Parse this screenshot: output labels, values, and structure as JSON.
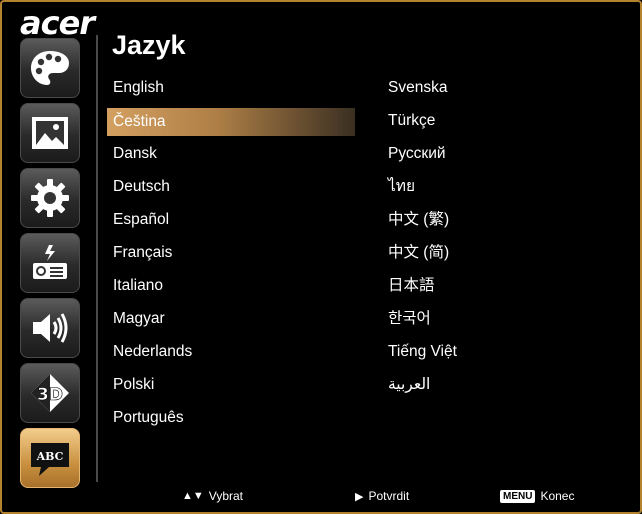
{
  "brand": "acer",
  "page_title": "Jazyk",
  "sidebar": {
    "items": [
      {
        "name": "palette-icon",
        "active": false
      },
      {
        "name": "picture-icon",
        "active": false
      },
      {
        "name": "gear-icon",
        "active": false
      },
      {
        "name": "projector-icon",
        "active": false
      },
      {
        "name": "speaker-icon",
        "active": false
      },
      {
        "name": "3d-icon",
        "active": false,
        "label": "3D"
      },
      {
        "name": "language-abc-icon",
        "active": true,
        "label": "ABC"
      }
    ]
  },
  "languages": {
    "left": [
      "English",
      "Čeština",
      "Dansk",
      "Deutsch",
      "Español",
      "Français",
      "Italiano",
      "Magyar",
      "Nederlands",
      "Polski",
      "Português"
    ],
    "right": [
      "Svenska",
      "Türkçe",
      "Русский",
      "ไทย",
      "中文 (繁)",
      "中文 (简)",
      "日本語",
      "한국어",
      "Tiếng Việt",
      "العربية"
    ],
    "selected": "Čeština"
  },
  "footer": {
    "nav_label": "Vybrat",
    "confirm_label": "Potvrdit",
    "menu_key": "MENU",
    "exit_label": "Konec"
  },
  "colors": {
    "frame_border": "#b5832e",
    "selection_gradient_start": "#d4a061",
    "active_tile": "#c9913f"
  }
}
